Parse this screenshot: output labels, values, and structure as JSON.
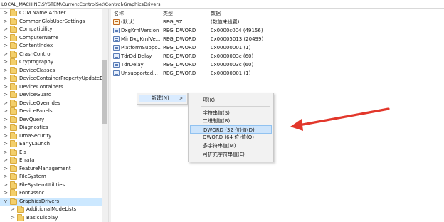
{
  "address": "LOCAL_MACHINE\\SYSTEM\\CurrentControlSet\\Control\\GraphicsDrivers",
  "tree": [
    {
      "label": "COM Name Arbiter",
      "expander": ">"
    },
    {
      "label": "CommonGlobUserSettings",
      "expander": ">"
    },
    {
      "label": "Compatibility",
      "expander": ">"
    },
    {
      "label": "ComputerName",
      "expander": ">"
    },
    {
      "label": "ContentIndex",
      "expander": ">"
    },
    {
      "label": "CrashControl",
      "expander": ">"
    },
    {
      "label": "Cryptography",
      "expander": ">"
    },
    {
      "label": "DeviceClasses",
      "expander": ">"
    },
    {
      "label": "DeviceContainerPropertyUpdateEve",
      "expander": ">"
    },
    {
      "label": "DeviceContainers",
      "expander": ">"
    },
    {
      "label": "DeviceGuard",
      "expander": ">"
    },
    {
      "label": "DeviceOverrides",
      "expander": ">"
    },
    {
      "label": "DevicePanels",
      "expander": ">"
    },
    {
      "label": "DevQuery",
      "expander": ">"
    },
    {
      "label": "Diagnostics",
      "expander": ">"
    },
    {
      "label": "DmaSecurity",
      "expander": ">"
    },
    {
      "label": "EarlyLaunch",
      "expander": ">"
    },
    {
      "label": "Els",
      "expander": ">"
    },
    {
      "label": "Errata",
      "expander": ">"
    },
    {
      "label": "FeatureManagement",
      "expander": ">"
    },
    {
      "label": "FileSystem",
      "expander": ">"
    },
    {
      "label": "FileSystemUtilities",
      "expander": ">"
    },
    {
      "label": "FontAssoc",
      "expander": ">"
    },
    {
      "label": "GraphicsDrivers",
      "expander": "v",
      "selected": true
    },
    {
      "label": "AdditionalModeLists",
      "expander": ">",
      "child": true
    },
    {
      "label": "BasicDisplay",
      "expander": ">",
      "child": true
    }
  ],
  "columns": {
    "name": "名称",
    "type": "类型",
    "data": "数据"
  },
  "values": [
    {
      "name": "(默认)",
      "type": "REG_SZ",
      "data": "(数值未设置)",
      "kind": "sz"
    },
    {
      "name": "DxgKrnlVersion",
      "type": "REG_DWORD",
      "data": "0x0000c004 (49156)",
      "kind": "dword"
    },
    {
      "name": "MinDxgKrnlVe...",
      "type": "REG_DWORD",
      "data": "0x00005013 (20499)",
      "kind": "dword"
    },
    {
      "name": "PlatformSuppo...",
      "type": "REG_DWORD",
      "data": "0x00000001 (1)",
      "kind": "dword"
    },
    {
      "name": "TdrDdiDelay",
      "type": "REG_DWORD",
      "data": "0x0000003c (60)",
      "kind": "dword"
    },
    {
      "name": "TdrDelay",
      "type": "REG_DWORD",
      "data": "0x0000003c (60)",
      "kind": "dword"
    },
    {
      "name": "Unsupported...",
      "type": "REG_DWORD",
      "data": "0x00000001 (1)",
      "kind": "dword"
    }
  ],
  "context_menu": {
    "new_label": "新建(N)",
    "arrow": ">",
    "submenu": [
      {
        "label": "项(K)"
      },
      {
        "separator": true
      },
      {
        "label": "字符串值(S)"
      },
      {
        "label": "二进制值(B)"
      },
      {
        "label": "DWORD (32 位)值(D)",
        "highlighted": true
      },
      {
        "label": "QWORD (64 位)值(Q)"
      },
      {
        "label": "多字符串值(M)"
      },
      {
        "label": "可扩充字符串值(E)"
      }
    ]
  },
  "annotation": {
    "arrow_color": "#e2372b"
  }
}
